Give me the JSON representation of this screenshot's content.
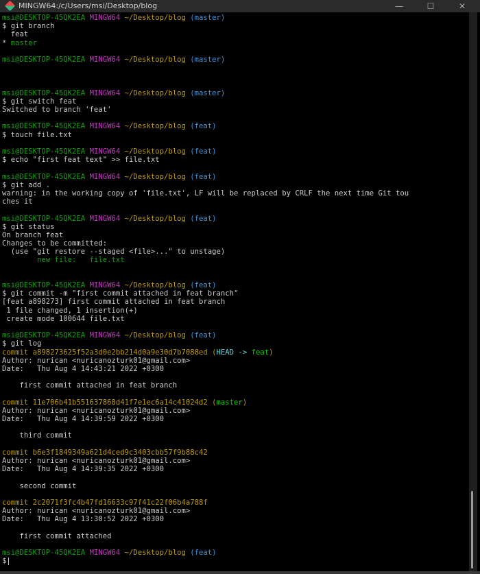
{
  "window": {
    "title": "MINGW64:/c/Users/msi/Desktop/blog",
    "minimize": "—",
    "maximize": "☐",
    "close": "✕"
  },
  "scrollbar": {
    "position_fraction": 0.86,
    "visible_fraction": 0.14
  },
  "colors": {
    "green": "#13a10e",
    "magenta": "#c239c0",
    "yellow": "#c19c00",
    "cyan": "#3a96dd"
  },
  "lines": [
    [
      [
        "g",
        "msi@DESKTOP-45QK2EA "
      ],
      [
        "m",
        "MINGW64 "
      ],
      [
        "y",
        "~/Desktop/blog "
      ],
      [
        "c",
        "(master)"
      ]
    ],
    [
      [
        "w",
        "$ git branch"
      ]
    ],
    [
      [
        "w",
        "  feat"
      ]
    ],
    [
      [
        "w",
        "* "
      ],
      [
        "g",
        "master"
      ]
    ],
    [],
    [
      [
        "g",
        "msi@DESKTOP-45QK2EA "
      ],
      [
        "m",
        "MINGW64 "
      ],
      [
        "y",
        "~/Desktop/blog "
      ],
      [
        "c",
        "(master)"
      ]
    ],
    [],
    [],
    [],
    [
      [
        "g",
        "msi@DESKTOP-45QK2EA "
      ],
      [
        "m",
        "MINGW64 "
      ],
      [
        "y",
        "~/Desktop/blog "
      ],
      [
        "c",
        "(master)"
      ]
    ],
    [
      [
        "w",
        "$ git switch feat"
      ]
    ],
    [
      [
        "w",
        "Switched to branch 'feat'"
      ]
    ],
    [],
    [
      [
        "g",
        "msi@DESKTOP-45QK2EA "
      ],
      [
        "m",
        "MINGW64 "
      ],
      [
        "y",
        "~/Desktop/blog "
      ],
      [
        "c",
        "(feat)"
      ]
    ],
    [
      [
        "w",
        "$ touch file.txt"
      ]
    ],
    [],
    [
      [
        "g",
        "msi@DESKTOP-45QK2EA "
      ],
      [
        "m",
        "MINGW64 "
      ],
      [
        "y",
        "~/Desktop/blog "
      ],
      [
        "c",
        "(feat)"
      ]
    ],
    [
      [
        "w",
        "$ echo \"first feat text\" >> file.txt"
      ]
    ],
    [],
    [
      [
        "g",
        "msi@DESKTOP-45QK2EA "
      ],
      [
        "m",
        "MINGW64 "
      ],
      [
        "y",
        "~/Desktop/blog "
      ],
      [
        "c",
        "(feat)"
      ]
    ],
    [
      [
        "w",
        "$ git add ."
      ]
    ],
    [
      [
        "w",
        "warning: in the working copy of 'file.txt', LF will be replaced by CRLF the next time Git tou"
      ]
    ],
    [
      [
        "w",
        "ches it"
      ]
    ],
    [],
    [
      [
        "g",
        "msi@DESKTOP-45QK2EA "
      ],
      [
        "m",
        "MINGW64 "
      ],
      [
        "y",
        "~/Desktop/blog "
      ],
      [
        "c",
        "(feat)"
      ]
    ],
    [
      [
        "w",
        "$ git status"
      ]
    ],
    [
      [
        "w",
        "On branch feat"
      ]
    ],
    [
      [
        "w",
        "Changes to be committed:"
      ]
    ],
    [
      [
        "w",
        "  (use \"git restore --staged <file>...\" to unstage)"
      ]
    ],
    [
      [
        "g",
        "        new file:   file.txt"
      ]
    ],
    [],
    [],
    [
      [
        "g",
        "msi@DESKTOP-45QK2EA "
      ],
      [
        "m",
        "MINGW64 "
      ],
      [
        "y",
        "~/Desktop/blog "
      ],
      [
        "c",
        "(feat)"
      ]
    ],
    [
      [
        "w",
        "$ git commit -m \"first commit attached in feat branch\""
      ]
    ],
    [
      [
        "w",
        "[feat a898273] first commit attached in feat branch"
      ]
    ],
    [
      [
        "w",
        " 1 file changed, 1 insertion(+)"
      ]
    ],
    [
      [
        "w",
        " create mode 100644 file.txt"
      ]
    ],
    [],
    [
      [
        "g",
        "msi@DESKTOP-45QK2EA "
      ],
      [
        "m",
        "MINGW64 "
      ],
      [
        "y",
        "~/Desktop/blog "
      ],
      [
        "c",
        "(feat)"
      ]
    ],
    [
      [
        "w",
        "$ git log"
      ]
    ],
    [
      [
        "y",
        "commit a898273625f52a3d0e2bb214d0a9e30d7b7088ed "
      ],
      [
        "y",
        "("
      ],
      [
        "cl",
        "HEAD -> "
      ],
      [
        "gl",
        "feat"
      ],
      [
        "y",
        ")"
      ]
    ],
    [
      [
        "w",
        "Author: nurican <nuricanozturk01@gmail.com>"
      ]
    ],
    [
      [
        "w",
        "Date:   Thu Aug 4 14:43:21 2022 +0300"
      ]
    ],
    [],
    [
      [
        "w",
        "    first commit attached in feat branch"
      ]
    ],
    [],
    [
      [
        "y",
        "commit 11e706b41b551637868d41f7e1ec6a14c41024d2 "
      ],
      [
        "y",
        "("
      ],
      [
        "gl",
        "master"
      ],
      [
        "y",
        ")"
      ]
    ],
    [
      [
        "w",
        "Author: nurican <nuricanozturk01@gmail.com>"
      ]
    ],
    [
      [
        "w",
        "Date:   Thu Aug 4 14:39:59 2022 +0300"
      ]
    ],
    [],
    [
      [
        "w",
        "    third commit"
      ]
    ],
    [],
    [
      [
        "y",
        "commit b6e3f1849349a621d4ced9c3403cbb57f9b88c42"
      ]
    ],
    [
      [
        "w",
        "Author: nurican <nuricanozturk01@gmail.com>"
      ]
    ],
    [
      [
        "w",
        "Date:   Thu Aug 4 14:39:35 2022 +0300"
      ]
    ],
    [],
    [
      [
        "w",
        "    second commit"
      ]
    ],
    [],
    [
      [
        "y",
        "commit 2c2071f3fc4b47fd16633c97f41c22f06b4a788f"
      ]
    ],
    [
      [
        "w",
        "Author: nurican <nuricanozturk01@gmail.com>"
      ]
    ],
    [
      [
        "w",
        "Date:   Thu Aug 4 13:30:52 2022 +0300"
      ]
    ],
    [],
    [
      [
        "w",
        "    first commit attached"
      ]
    ],
    [],
    [
      [
        "g",
        "msi@DESKTOP-45QK2EA "
      ],
      [
        "m",
        "MINGW64 "
      ],
      [
        "y",
        "~/Desktop/blog "
      ],
      [
        "c",
        "(feat)"
      ]
    ],
    [
      [
        "w",
        "$"
      ]
    ]
  ]
}
